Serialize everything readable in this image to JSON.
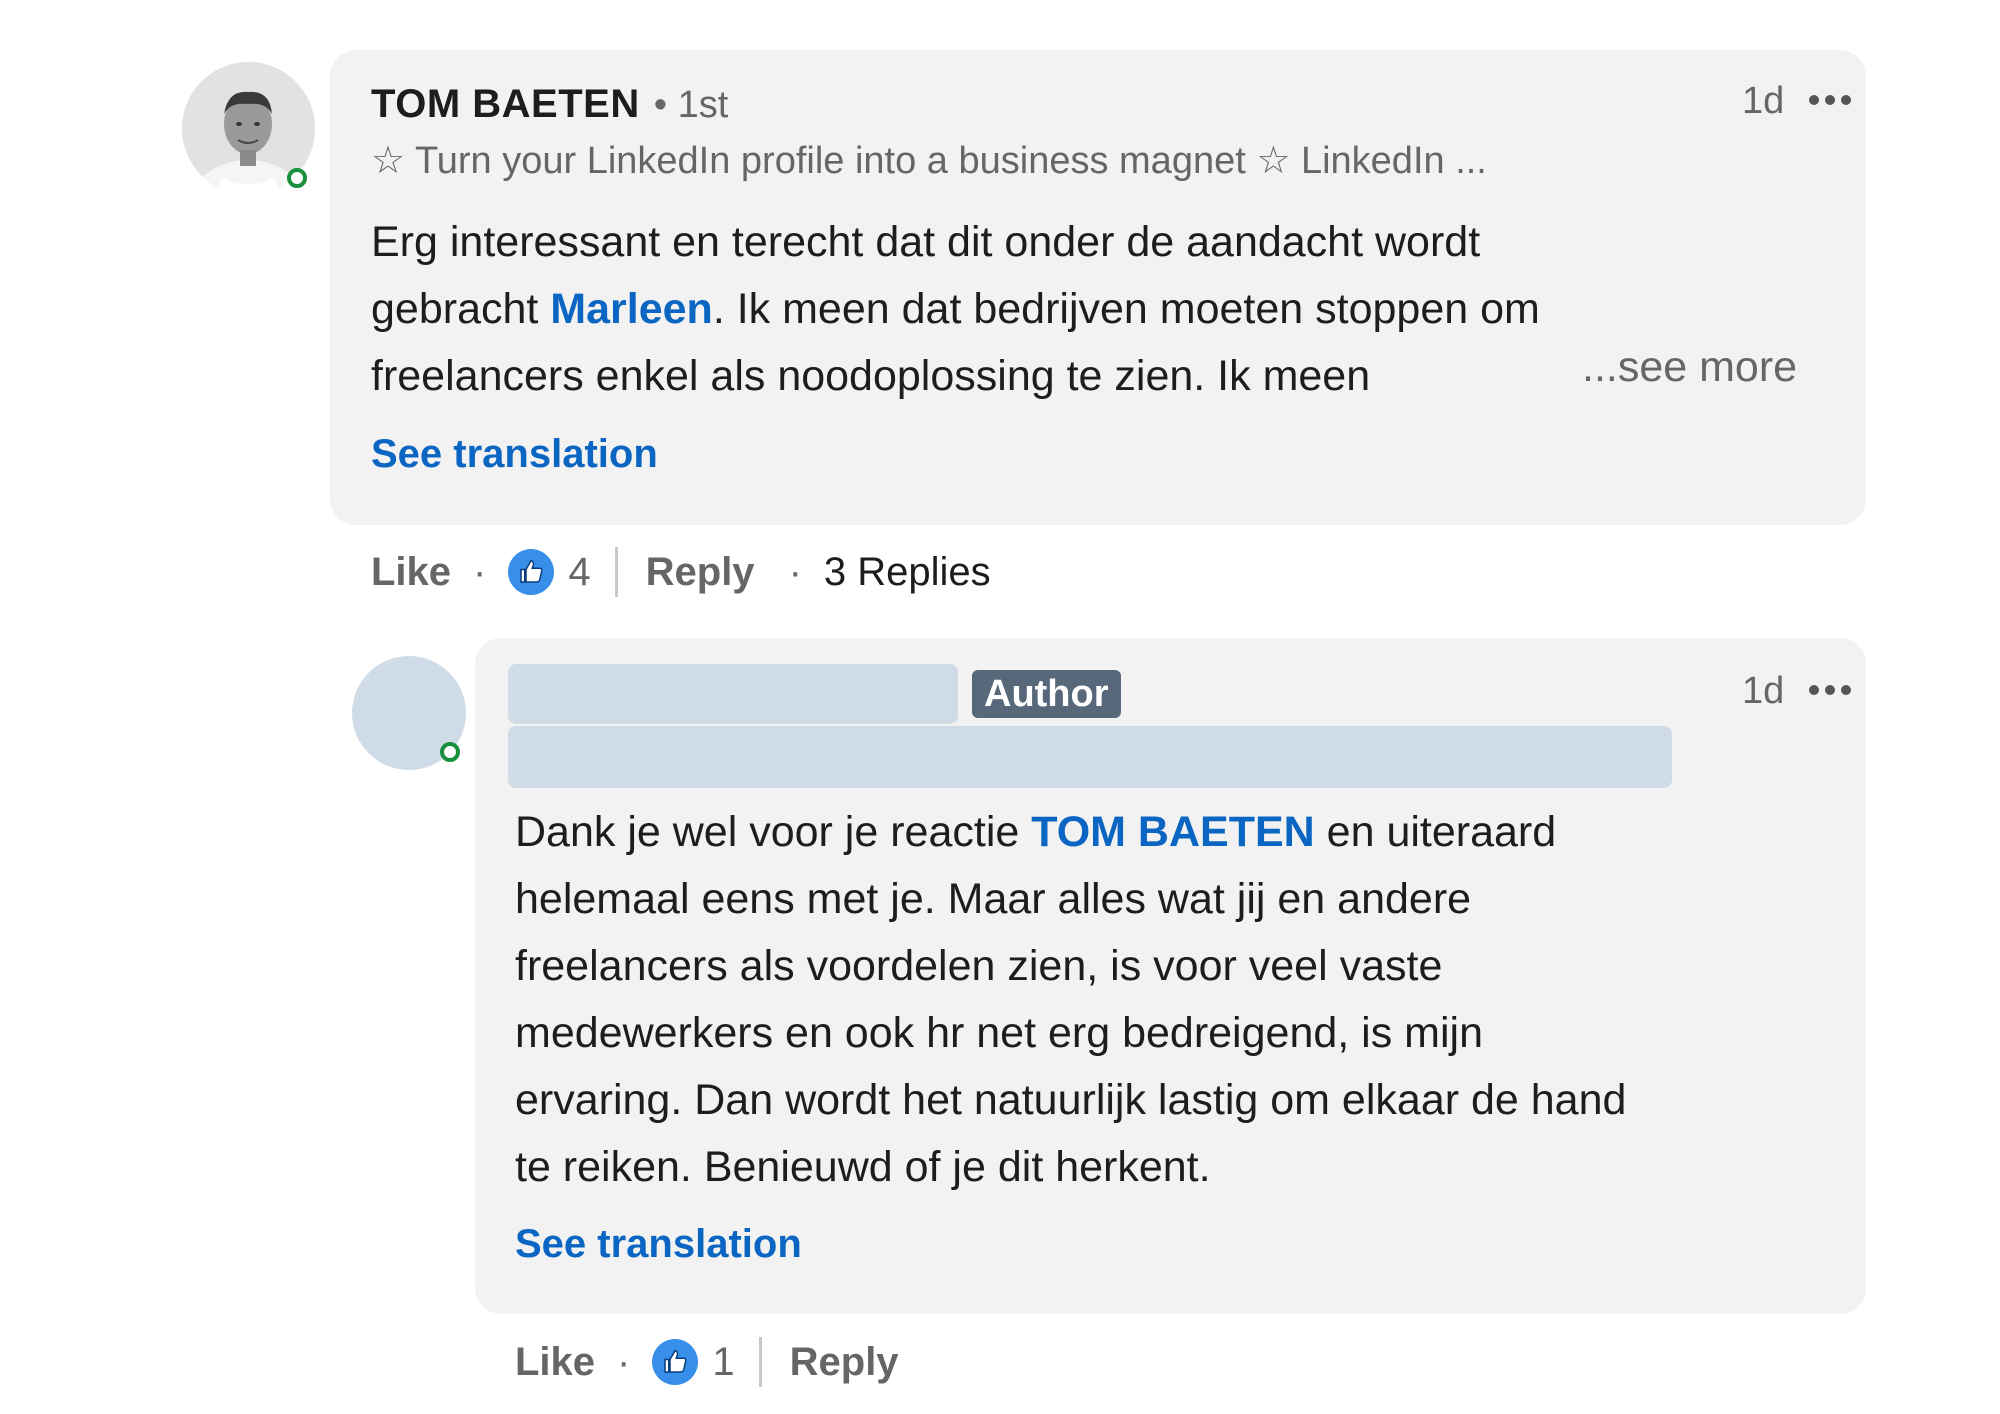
{
  "comment": {
    "author_name": "TOM BAETEN",
    "connection_degree": "• 1st",
    "headline": "☆ Turn your LinkedIn profile into a business magnet ☆ LinkedIn ...",
    "time": "1d",
    "options_icon": "more-horizontal-icon",
    "body_line1": "Erg interessant en terecht dat dit onder de aandacht wordt",
    "body_line2_pre": "gebracht ",
    "body_mention": "Marleen",
    "body_line2_post": ". Ik meen dat bedrijven moeten stoppen om",
    "body_line3": "freelancers enkel als noodoplossing te zien. Ik meen",
    "see_more": "...see more",
    "see_translation": "See translation",
    "actions": {
      "like": "Like",
      "reaction_icon": "like-thumb-icon",
      "reaction_count": "4",
      "reply": "Reply",
      "replies": "3 Replies"
    }
  },
  "reply": {
    "badge": "Author",
    "time": "1d",
    "options_icon": "more-horizontal-icon",
    "line1_pre": "Dank je wel voor je reactie ",
    "line1_mention": "TOM BAETEN",
    "line1_post": " en uiteraard",
    "line2": "helemaal eens met je. Maar alles wat jij en andere",
    "line3": "freelancers als voordelen zien, is voor veel vaste",
    "line4": "medewerkers en ook hr net erg bedreigend, is mijn",
    "line5": "ervaring. Dan wordt het natuurlijk lastig om elkaar de hand",
    "line6": "te reiken. Benieuwd of je dit herkent.",
    "see_translation": "See translation",
    "actions": {
      "like": "Like",
      "reaction_icon": "like-thumb-icon",
      "reaction_count": "1",
      "reply": "Reply"
    }
  },
  "colors": {
    "link_blue": "#0a66c2",
    "bubble_bg": "#f2f2f2",
    "online_green": "#178f3c",
    "author_badge_bg": "#56687a",
    "redaction": "#cfdce7"
  }
}
